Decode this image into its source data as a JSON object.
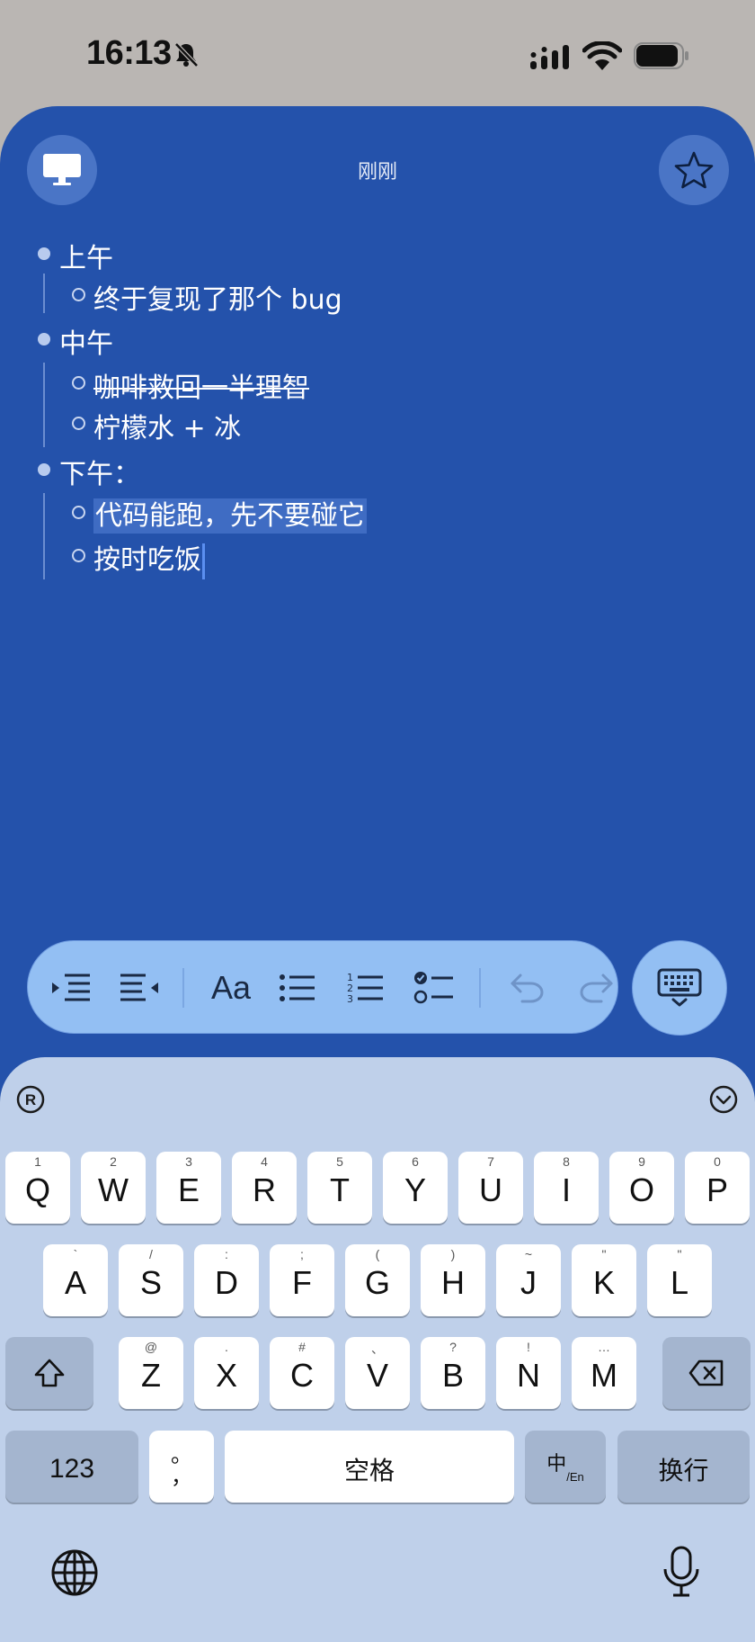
{
  "status_bar": {
    "time": "16:13",
    "icons": [
      "bell-slash-icon",
      "signal-icon",
      "wifi-icon",
      "battery-icon"
    ]
  },
  "note": {
    "date_label": "刚刚",
    "left_button": "desktop-icon",
    "right_button": "star-icon",
    "sections": [
      {
        "label": "上午",
        "items": [
          {
            "text": "终于复现了那个 bug",
            "strike": false,
            "selected": false
          }
        ]
      },
      {
        "label": "中午",
        "items": [
          {
            "text": "咖啡救回一半理智",
            "strike": true,
            "selected": false
          },
          {
            "text": "柠檬水 + 冰",
            "strike": false,
            "selected": false
          }
        ]
      },
      {
        "label": "下午：",
        "items": [
          {
            "text": "代码能跑，先不要碰它",
            "strike": false,
            "selected": true
          },
          {
            "text": "按时吃饭",
            "strike": false,
            "selected": false,
            "caret": true
          }
        ]
      }
    ]
  },
  "toolbar": {
    "tools": [
      "indent-icon",
      "outdent-icon",
      "format-text",
      "bullet-list-icon",
      "numbered-list-icon",
      "checklist-icon",
      "undo-icon",
      "redo-icon"
    ],
    "format_label": "Aa",
    "keyboard_button": "keyboard-dismiss-icon"
  },
  "keyboard": {
    "row1": [
      {
        "k": "Q",
        "h": "1"
      },
      {
        "k": "W",
        "h": "2"
      },
      {
        "k": "E",
        "h": "3"
      },
      {
        "k": "R",
        "h": "4"
      },
      {
        "k": "T",
        "h": "5"
      },
      {
        "k": "Y",
        "h": "6"
      },
      {
        "k": "U",
        "h": "7"
      },
      {
        "k": "I",
        "h": "8"
      },
      {
        "k": "O",
        "h": "9"
      },
      {
        "k": "P",
        "h": "0"
      }
    ],
    "row2": [
      {
        "k": "A",
        "h": "`"
      },
      {
        "k": "S",
        "h": "/"
      },
      {
        "k": "D",
        "h": ":"
      },
      {
        "k": "F",
        "h": ";"
      },
      {
        "k": "G",
        "h": "("
      },
      {
        "k": "H",
        "h": ")"
      },
      {
        "k": "J",
        "h": "~"
      },
      {
        "k": "K",
        "h": "\""
      },
      {
        "k": "L",
        "h": "\""
      }
    ],
    "row3": [
      {
        "k": "Z",
        "h": "@"
      },
      {
        "k": "X",
        "h": "."
      },
      {
        "k": "C",
        "h": "#"
      },
      {
        "k": "V",
        "h": "、"
      },
      {
        "k": "B",
        "h": "?"
      },
      {
        "k": "N",
        "h": "!"
      },
      {
        "k": "M",
        "h": "…"
      }
    ],
    "numbers_key": "123",
    "punct_key": "。\n，",
    "punct_top": "。",
    "punct_bottom": "，",
    "space_key": "空格",
    "lang_key_main": "中",
    "lang_key_sub": "/En",
    "return_key": "换行"
  }
}
